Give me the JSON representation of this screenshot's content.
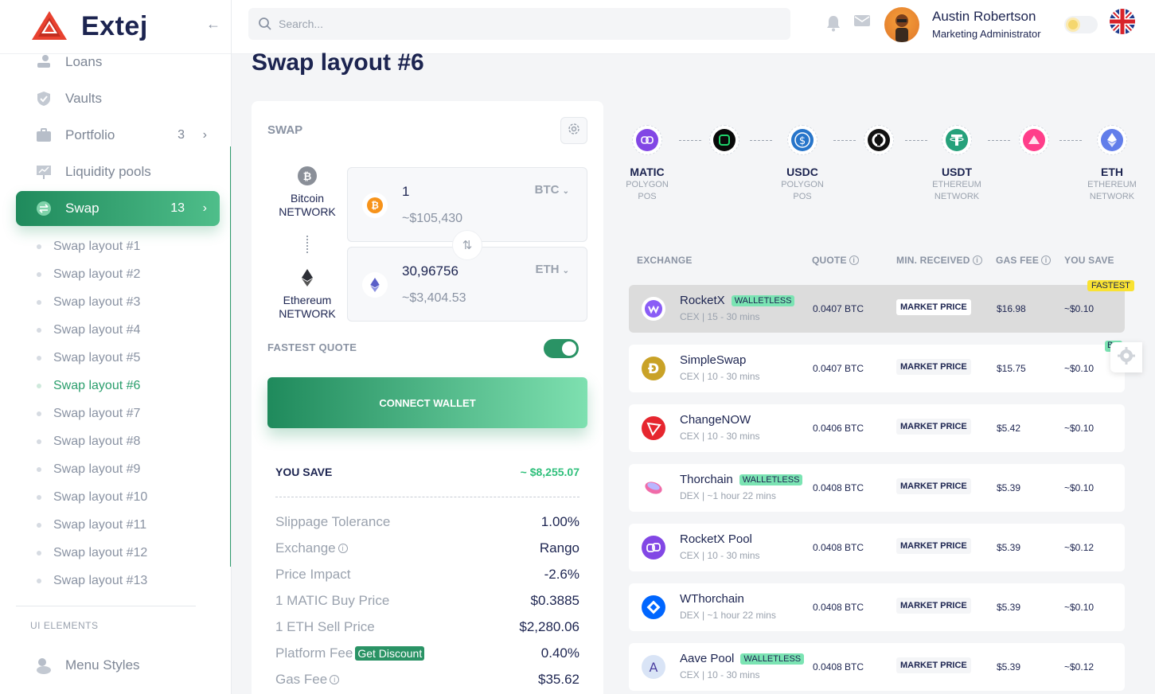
{
  "app": {
    "name": "Extej",
    "brand_color": "#e8412f",
    "accent": "#2a9365"
  },
  "sidebar": {
    "items": [
      {
        "label": "Loans",
        "icon": "hand-coin-icon"
      },
      {
        "label": "Vaults",
        "icon": "shield-icon"
      },
      {
        "label": "Portfolio",
        "icon": "briefcase-icon",
        "count": "3"
      },
      {
        "label": "Liquidity pools",
        "icon": "chart-board-icon"
      },
      {
        "label": "Swap",
        "icon": "swap-icon",
        "count": "13",
        "active": true
      }
    ],
    "sub_items": [
      "Swap layout #1",
      "Swap layout #2",
      "Swap layout #3",
      "Swap layout #4",
      "Swap layout #5",
      "Swap layout #6",
      "Swap layout #7",
      "Swap layout #8",
      "Swap layout #9",
      "Swap layout #10",
      "Swap layout #11",
      "Swap layout #12",
      "Swap layout #13"
    ],
    "active_sub": "Swap layout #6",
    "section_label": "UI ELEMENTS",
    "menu_styles": "Menu Styles"
  },
  "header": {
    "search_placeholder": "Search...",
    "user_name": "Austin Robertson",
    "user_role": "Marketing Administrator"
  },
  "page": {
    "title": "Swap layout #6"
  },
  "swap": {
    "label": "SWAP",
    "from": {
      "chain": "Bitcoin",
      "network": "NETWORK",
      "amount": "1",
      "usd": "~$105,430",
      "ticker": "BTC"
    },
    "to": {
      "chain": "Ethereum",
      "network": "NETWORK",
      "amount": "30,96756",
      "usd": "~$3,404.53",
      "ticker": "ETH"
    },
    "fastest_quote_label": "FASTEST QUOTE",
    "fastest_quote_on": true,
    "connect_label": "CONNECT WALLET",
    "you_save_label": "YOU SAVE",
    "you_save_value": "~ $8,255.07",
    "details": [
      {
        "k": "Slippage Tolerance",
        "v": "1.00%"
      },
      {
        "k": "Exchange",
        "v": "Rango",
        "info": true
      },
      {
        "k": "Price Impact",
        "v": "-2.6%"
      },
      {
        "k": "1 MATIC Buy Price",
        "v": "$0.3885"
      },
      {
        "k": "1 ETH Sell Price",
        "v": "$2,280.06"
      },
      {
        "k": "Platform Fee",
        "v": "0.40%",
        "badge": "Get Discount"
      },
      {
        "k": "Gas Fee",
        "v": "$35.62",
        "info": true
      }
    ]
  },
  "route": [
    {
      "sym": "MATIC",
      "net1": "POLYGON",
      "net2": "POS"
    },
    {
      "sym": "USDC",
      "net1": "POLYGON",
      "net2": "POS"
    },
    {
      "sym": "USDT",
      "net1": "ETHEREUM",
      "net2": "NETWORK"
    },
    {
      "sym": "ETH",
      "net1": "ETHEREUM",
      "net2": "NETWORK"
    }
  ],
  "table": {
    "headers": {
      "exchange": "EXCHANGE",
      "quote": "QUOTE",
      "min": "MIN. RECEIVED",
      "gas": "GAS FEE",
      "save": "YOU SAVE"
    },
    "fastest_badge": "FASTEST",
    "peek_badge": "B",
    "rows": [
      {
        "name": "RocketX",
        "badge": "WALLETLESS",
        "sub": "CEX | 15 - 30 mins",
        "quote": "0.0407 BTC",
        "min": "MARKET PRICE",
        "gas": "$16.98",
        "save": "~$0.10"
      },
      {
        "name": "SimpleSwap",
        "badge": "",
        "sub": "CEX | 10 - 30 mins",
        "quote": "0.0407 BTC",
        "min": "MARKET PRICE",
        "gas": "$15.75",
        "save": "~$0.10"
      },
      {
        "name": "ChangeNOW",
        "badge": "",
        "sub": "CEX | 10 - 30 mins",
        "quote": "0.0406 BTC",
        "min": "MARKET PRICE",
        "gas": "$5.42",
        "save": "~$0.10"
      },
      {
        "name": "Thorchain",
        "badge": "WALLETLESS",
        "sub": "DEX | ~1 hour 22 mins",
        "quote": "0.0408 BTC",
        "min": "MARKET PRICE",
        "gas": "$5.39",
        "save": "~$0.10"
      },
      {
        "name": "RocketX Pool",
        "badge": "",
        "sub": "CEX | 10 - 30 mins",
        "quote": "0.0408 BTC",
        "min": "MARKET PRICE",
        "gas": "$5.39",
        "save": "~$0.12"
      },
      {
        "name": "WThorchain",
        "badge": "",
        "sub": "DEX | ~1 hour 22 mins",
        "quote": "0.0408 BTC",
        "min": "MARKET PRICE",
        "gas": "$5.39",
        "save": "~$0.10"
      },
      {
        "name": "Aave Pool",
        "badge": "WALLETLESS",
        "sub": "CEX | 10 - 30 mins",
        "quote": "0.0408 BTC",
        "min": "MARKET PRICE",
        "gas": "$5.39",
        "save": "~$0.12"
      }
    ]
  }
}
